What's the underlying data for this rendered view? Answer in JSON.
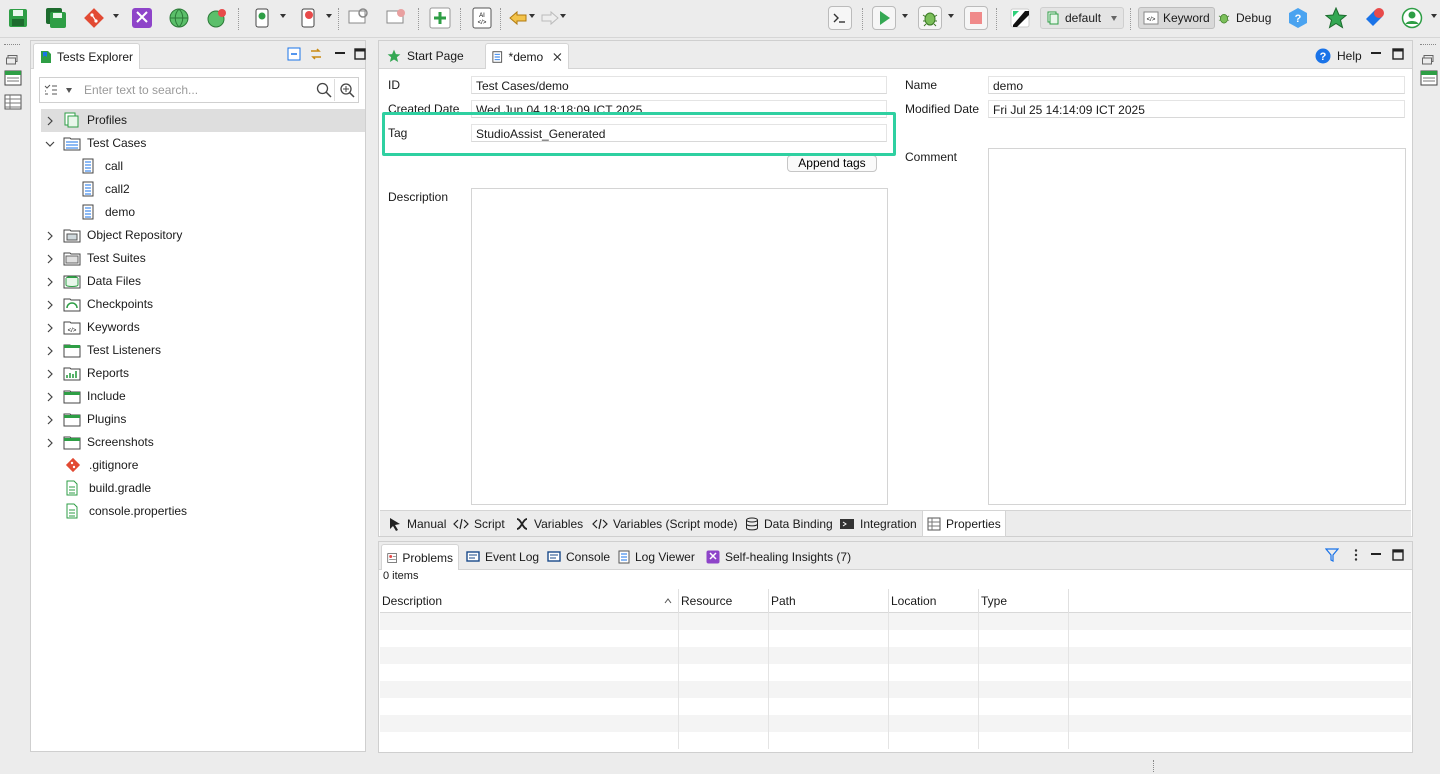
{
  "colors": {
    "highlight": "#2fd0a1",
    "run_green": "#34a853",
    "stop_red": "#e84a4a",
    "help_blue": "#1a73e8"
  },
  "toolbar": {
    "profile": "default",
    "perspective_keyword": "Keyword",
    "perspective_debug": "Debug"
  },
  "explorer": {
    "title": "Tests Explorer",
    "search_placeholder": "Enter text to search...",
    "items": [
      {
        "label": "Profiles",
        "icon": "profiles-icon",
        "expand": "collapsed",
        "level": 0
      },
      {
        "label": "Test Cases",
        "icon": "test-cases-folder-icon",
        "expand": "expanded",
        "level": 0
      },
      {
        "label": "call",
        "icon": "test-case-icon",
        "expand": "none",
        "level": 1
      },
      {
        "label": "call2",
        "icon": "test-case-icon",
        "expand": "none",
        "level": 1
      },
      {
        "label": "demo",
        "icon": "test-case-icon",
        "expand": "none",
        "level": 1
      },
      {
        "label": "Object Repository",
        "icon": "object-repository-icon",
        "expand": "collapsed",
        "level": 0
      },
      {
        "label": "Test Suites",
        "icon": "test-suites-icon",
        "expand": "collapsed",
        "level": 0
      },
      {
        "label": "Data Files",
        "icon": "data-files-icon",
        "expand": "collapsed",
        "level": 0
      },
      {
        "label": "Checkpoints",
        "icon": "checkpoints-icon",
        "expand": "collapsed",
        "level": 0
      },
      {
        "label": "Keywords",
        "icon": "keywords-icon",
        "expand": "collapsed",
        "level": 0
      },
      {
        "label": "Test Listeners",
        "icon": "test-listeners-icon",
        "expand": "collapsed",
        "level": 0
      },
      {
        "label": "Reports",
        "icon": "reports-icon",
        "expand": "collapsed",
        "level": 0
      },
      {
        "label": "Include",
        "icon": "folder-icon",
        "expand": "collapsed",
        "level": 0
      },
      {
        "label": "Plugins",
        "icon": "folder-icon",
        "expand": "collapsed",
        "level": 0
      },
      {
        "label": "Screenshots",
        "icon": "folder-icon",
        "expand": "collapsed",
        "level": 0
      },
      {
        "label": ".gitignore",
        "icon": "git-file-icon",
        "expand": "none",
        "level": 0
      },
      {
        "label": "build.gradle",
        "icon": "text-file-icon",
        "expand": "none",
        "level": 0
      },
      {
        "label": "console.properties",
        "icon": "text-file-icon",
        "expand": "none",
        "level": 0
      }
    ]
  },
  "editor": {
    "tabs": {
      "start_page": "Start Page",
      "demo": "*demo",
      "help": "Help"
    },
    "fields": {
      "id_label": "ID",
      "id_value": "Test Cases/demo",
      "created_label": "Created Date",
      "created_value": "Wed Jun 04 18:18:09 ICT 2025",
      "tag_label": "Tag",
      "tag_value": "StudioAssist_Generated",
      "append_tags": "Append tags",
      "description_label": "Description",
      "name_label": "Name",
      "name_value": "demo",
      "modified_label": "Modified Date",
      "modified_value": "Fri Jul 25 14:14:09 ICT 2025",
      "comment_label": "Comment"
    },
    "bottom_tabs": {
      "manual": "Manual",
      "script": "Script",
      "variables": "Variables",
      "variables_script": "Variables (Script mode)",
      "data_binding": "Data Binding",
      "integration": "Integration",
      "properties": "Properties"
    }
  },
  "problems": {
    "tabs": {
      "problems": "Problems",
      "event_log": "Event Log",
      "console": "Console",
      "log_viewer": "Log Viewer",
      "self_healing": "Self-healing Insights (7)"
    },
    "items_count": "0 items",
    "columns": [
      "Description",
      "Resource",
      "Path",
      "Location",
      "Type"
    ]
  }
}
